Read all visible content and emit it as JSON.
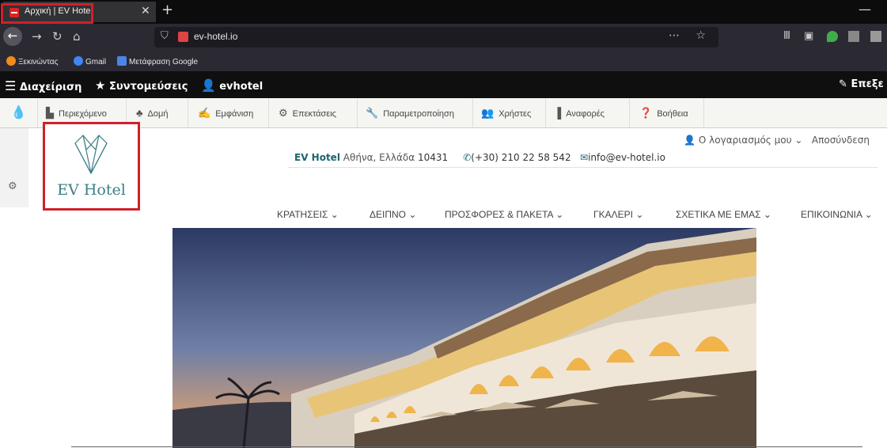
{
  "browser": {
    "tab_title": "Αρχική | EV Hotel",
    "url": "ev-hotel.io",
    "bookmarks": [
      "Ξεκινώντας",
      "Gmail",
      "Μετάφραση Google"
    ]
  },
  "admin_toolbar": {
    "manage": "Διαχείριση",
    "shortcuts": "Συντομεύσεις",
    "user": "evhotel",
    "edit": "Επεξε",
    "items": [
      "Περιεχόμενο",
      "Δομή",
      "Εμφάνιση",
      "Επεκτάσεις",
      "Παραμετροποίηση",
      "Χρήστες",
      "Αναφορές",
      "Βοήθεια"
    ]
  },
  "site": {
    "logo_text": "EV Hotel",
    "brand": "EV Hotel",
    "address": "Αθήνα, Ελλάδα",
    "postcode": "10431",
    "phone": "(+30) 210 22 58 542",
    "email": "info@ev-hotel.io",
    "account": "Ο λογαριασμός μου",
    "logout": "Αποσύνδεση",
    "menu": [
      "ΚΡΑΤΗΣΕΙΣ",
      "ΔΕΙΠΝΟ",
      "ΠΡΟΣΦΟΡΕΣ & ΠΑΚΕΤΑ",
      "ΓΚΑΛΕΡΙ",
      "ΣΧΕΤΙΚΑ ΜΕ ΕΜΑΣ",
      "ΕΠΙΚΟΙΝΩΝΙΑ"
    ]
  }
}
